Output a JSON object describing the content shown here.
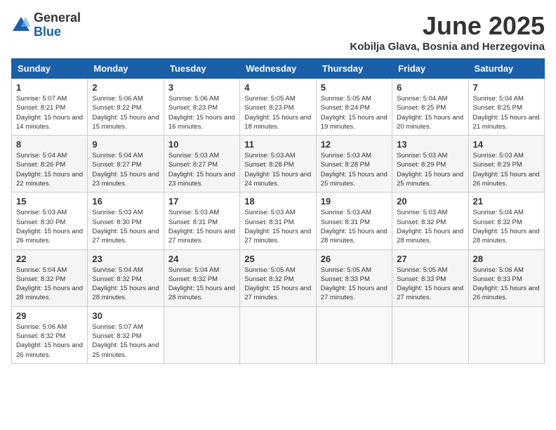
{
  "logo": {
    "general": "General",
    "blue": "Blue"
  },
  "header": {
    "month": "June 2025",
    "location": "Kobilja Glava, Bosnia and Herzegovina"
  },
  "weekdays": [
    "Sunday",
    "Monday",
    "Tuesday",
    "Wednesday",
    "Thursday",
    "Friday",
    "Saturday"
  ],
  "weeks": [
    [
      {
        "day": "1",
        "sunrise": "5:07 AM",
        "sunset": "8:21 PM",
        "daylight": "15 hours and 14 minutes."
      },
      {
        "day": "2",
        "sunrise": "5:06 AM",
        "sunset": "8:22 PM",
        "daylight": "15 hours and 15 minutes."
      },
      {
        "day": "3",
        "sunrise": "5:06 AM",
        "sunset": "8:23 PM",
        "daylight": "15 hours and 16 minutes."
      },
      {
        "day": "4",
        "sunrise": "5:05 AM",
        "sunset": "8:23 PM",
        "daylight": "15 hours and 18 minutes."
      },
      {
        "day": "5",
        "sunrise": "5:05 AM",
        "sunset": "8:24 PM",
        "daylight": "15 hours and 19 minutes."
      },
      {
        "day": "6",
        "sunrise": "5:04 AM",
        "sunset": "8:25 PM",
        "daylight": "15 hours and 20 minutes."
      },
      {
        "day": "7",
        "sunrise": "5:04 AM",
        "sunset": "8:25 PM",
        "daylight": "15 hours and 21 minutes."
      }
    ],
    [
      {
        "day": "8",
        "sunrise": "5:04 AM",
        "sunset": "8:26 PM",
        "daylight": "15 hours and 22 minutes."
      },
      {
        "day": "9",
        "sunrise": "5:04 AM",
        "sunset": "8:27 PM",
        "daylight": "15 hours and 23 minutes."
      },
      {
        "day": "10",
        "sunrise": "5:03 AM",
        "sunset": "8:27 PM",
        "daylight": "15 hours and 23 minutes."
      },
      {
        "day": "11",
        "sunrise": "5:03 AM",
        "sunset": "8:28 PM",
        "daylight": "15 hours and 24 minutes."
      },
      {
        "day": "12",
        "sunrise": "5:03 AM",
        "sunset": "8:28 PM",
        "daylight": "15 hours and 25 minutes."
      },
      {
        "day": "13",
        "sunrise": "5:03 AM",
        "sunset": "8:29 PM",
        "daylight": "15 hours and 25 minutes."
      },
      {
        "day": "14",
        "sunrise": "5:03 AM",
        "sunset": "8:29 PM",
        "daylight": "15 hours and 26 minutes."
      }
    ],
    [
      {
        "day": "15",
        "sunrise": "5:03 AM",
        "sunset": "8:30 PM",
        "daylight": "15 hours and 26 minutes."
      },
      {
        "day": "16",
        "sunrise": "5:03 AM",
        "sunset": "8:30 PM",
        "daylight": "15 hours and 27 minutes."
      },
      {
        "day": "17",
        "sunrise": "5:03 AM",
        "sunset": "8:31 PM",
        "daylight": "15 hours and 27 minutes."
      },
      {
        "day": "18",
        "sunrise": "5:03 AM",
        "sunset": "8:31 PM",
        "daylight": "15 hours and 27 minutes."
      },
      {
        "day": "19",
        "sunrise": "5:03 AM",
        "sunset": "8:31 PM",
        "daylight": "15 hours and 28 minutes."
      },
      {
        "day": "20",
        "sunrise": "5:03 AM",
        "sunset": "8:32 PM",
        "daylight": "15 hours and 28 minutes."
      },
      {
        "day": "21",
        "sunrise": "5:04 AM",
        "sunset": "8:32 PM",
        "daylight": "15 hours and 28 minutes."
      }
    ],
    [
      {
        "day": "22",
        "sunrise": "5:04 AM",
        "sunset": "8:32 PM",
        "daylight": "15 hours and 28 minutes."
      },
      {
        "day": "23",
        "sunrise": "5:04 AM",
        "sunset": "8:32 PM",
        "daylight": "15 hours and 28 minutes."
      },
      {
        "day": "24",
        "sunrise": "5:04 AM",
        "sunset": "8:32 PM",
        "daylight": "15 hours and 28 minutes."
      },
      {
        "day": "25",
        "sunrise": "5:05 AM",
        "sunset": "8:32 PM",
        "daylight": "15 hours and 27 minutes."
      },
      {
        "day": "26",
        "sunrise": "5:05 AM",
        "sunset": "8:33 PM",
        "daylight": "15 hours and 27 minutes."
      },
      {
        "day": "27",
        "sunrise": "5:05 AM",
        "sunset": "8:33 PM",
        "daylight": "15 hours and 27 minutes."
      },
      {
        "day": "28",
        "sunrise": "5:06 AM",
        "sunset": "8:33 PM",
        "daylight": "15 hours and 26 minutes."
      }
    ],
    [
      {
        "day": "29",
        "sunrise": "5:06 AM",
        "sunset": "8:32 PM",
        "daylight": "15 hours and 26 minutes."
      },
      {
        "day": "30",
        "sunrise": "5:07 AM",
        "sunset": "8:32 PM",
        "daylight": "15 hours and 25 minutes."
      },
      null,
      null,
      null,
      null,
      null
    ]
  ]
}
